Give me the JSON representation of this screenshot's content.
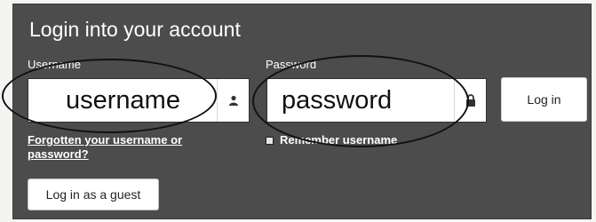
{
  "login_panel": {
    "title": "Login into your account",
    "username": {
      "label": "Username",
      "value": "username",
      "icon": "user-icon"
    },
    "password": {
      "label": "Password",
      "value": "password",
      "icon": "lock-icon"
    },
    "login_button": "Log in",
    "forgot_link": "Forgotten your username or password?",
    "remember_label": "Remember username",
    "remember_checked": false,
    "guest_button": "Log in as a guest"
  },
  "colors": {
    "panel_background": "#4c4c4c",
    "annotation_ink": "#111111"
  }
}
